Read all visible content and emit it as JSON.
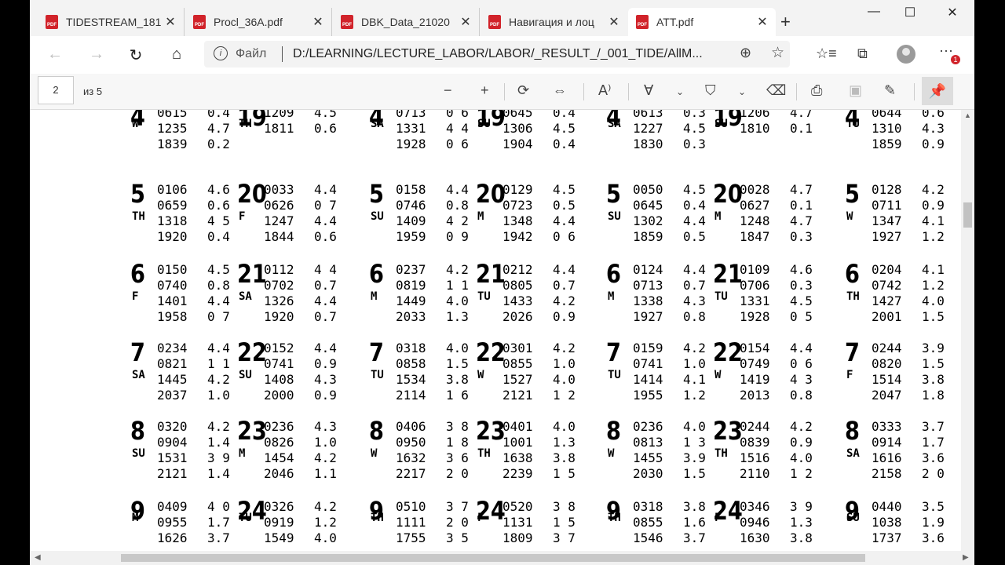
{
  "tabs": [
    {
      "title": "TIDESTREAM_181",
      "close": "✕"
    },
    {
      "title": "Procl_36A.pdf",
      "close": "✕"
    },
    {
      "title": "DBK_Data_21020",
      "close": "✕"
    },
    {
      "title": "Навигация и лоц",
      "close": "✕"
    },
    {
      "title": "ATT.pdf",
      "close": "✕"
    }
  ],
  "tab_icon_text": "PDF",
  "new_tab": "+",
  "window": {
    "minimize": "—",
    "maximize": "☐",
    "close": "✕"
  },
  "address": {
    "scheme_label": "Файл",
    "url": "D:/LEARNING/LECTURE_LABOR/LABOR/_RESULT_/_001_TIDE/AllM...",
    "notifications": "1"
  },
  "pdf_toolbar": {
    "page": "2",
    "of": "из 5"
  },
  "tide_rows": [
    {
      "cells": [
        {
          "day": "4",
          "wd": "W",
          "times": [
            "0615",
            "1235",
            "1839"
          ],
          "heights": [
            "0.4",
            "4.7",
            "0.2"
          ]
        },
        {
          "day": "19",
          "wd": "TH",
          "times": [
            "1209",
            "1811"
          ],
          "heights": [
            "4.5",
            "0.6"
          ]
        },
        {
          "day": "4",
          "wd": "SA",
          "times": [
            "0713",
            "1331",
            "1928"
          ],
          "heights": [
            "0 6",
            "4 4",
            "0 6"
          ]
        },
        {
          "day": "19",
          "wd": "SU",
          "times": [
            "0645",
            "1306",
            "1904"
          ],
          "heights": [
            "0.4",
            "4.5",
            "0.4"
          ]
        },
        {
          "day": "4",
          "wd": "SA",
          "times": [
            "0613",
            "1227",
            "1830"
          ],
          "heights": [
            "0.3",
            "4.5",
            "0.3"
          ]
        },
        {
          "day": "19",
          "wd": "SU",
          "times": [
            "1206",
            "1810"
          ],
          "heights": [
            "4.7",
            "0.1"
          ]
        },
        {
          "day": "4",
          "wd": "TU",
          "times": [
            "0644",
            "1310",
            "1859"
          ],
          "heights": [
            "0.6",
            "4.3",
            "0.9"
          ]
        }
      ]
    },
    {
      "cells": [
        {
          "day": "5",
          "wd": "TH",
          "times": [
            "0106",
            "0659",
            "1318",
            "1920"
          ],
          "heights": [
            "4.6",
            "0.6",
            "4 5",
            "0.4"
          ]
        },
        {
          "day": "20",
          "wd": "F",
          "times": [
            "0033",
            "0626",
            "1247",
            "1844"
          ],
          "heights": [
            "4.4",
            "0 7",
            "4.4",
            "0.6"
          ]
        },
        {
          "day": "5",
          "wd": "SU",
          "times": [
            "0158",
            "0746",
            "1409",
            "1959"
          ],
          "heights": [
            "4.4",
            "0.8",
            "4 2",
            "0 9"
          ]
        },
        {
          "day": "20",
          "wd": "M",
          "times": [
            "0129",
            "0723",
            "1348",
            "1942"
          ],
          "heights": [
            "4.5",
            "0.5",
            "4.4",
            "0 6"
          ]
        },
        {
          "day": "5",
          "wd": "SU",
          "times": [
            "0050",
            "0645",
            "1302",
            "1859"
          ],
          "heights": [
            "4.5",
            "0.4",
            "4.4",
            "0.5"
          ]
        },
        {
          "day": "20",
          "wd": "M",
          "times": [
            "0028",
            "0627",
            "1248",
            "1847"
          ],
          "heights": [
            "4.7",
            "0.1",
            "4.7",
            "0.3"
          ]
        },
        {
          "day": "5",
          "wd": "W",
          "times": [
            "0128",
            "0711",
            "1347",
            "1927"
          ],
          "heights": [
            "4.2",
            "0.9",
            "4.1",
            "1.2"
          ]
        }
      ]
    },
    {
      "cells": [
        {
          "day": "6",
          "wd": "F",
          "times": [
            "0150",
            "0740",
            "1401",
            "1958"
          ],
          "heights": [
            "4.5",
            "0.8",
            "4.4",
            "0 7"
          ]
        },
        {
          "day": "21",
          "wd": "SA",
          "times": [
            "0112",
            "0702",
            "1326",
            "1920"
          ],
          "heights": [
            "4 4",
            "0.7",
            "4.4",
            "0.7"
          ]
        },
        {
          "day": "6",
          "wd": "M",
          "times": [
            "0237",
            "0819",
            "1449",
            "2033"
          ],
          "heights": [
            "4.2",
            "1 1",
            "4.0",
            "1.3"
          ]
        },
        {
          "day": "21",
          "wd": "TU",
          "times": [
            "0212",
            "0805",
            "1433",
            "2026"
          ],
          "heights": [
            "4.4",
            "0.7",
            "4.2",
            "0.9"
          ]
        },
        {
          "day": "6",
          "wd": "M",
          "times": [
            "0124",
            "0713",
            "1338",
            "1927"
          ],
          "heights": [
            "4.4",
            "0.7",
            "4.3",
            "0.8"
          ]
        },
        {
          "day": "21",
          "wd": "TU",
          "times": [
            "0109",
            "0706",
            "1331",
            "1928"
          ],
          "heights": [
            "4.6",
            "0.3",
            "4.5",
            "0 5"
          ]
        },
        {
          "day": "6",
          "wd": "TH",
          "times": [
            "0204",
            "0742",
            "1427",
            "2001"
          ],
          "heights": [
            "4.1",
            "1.2",
            "4.0",
            "1.5"
          ]
        }
      ]
    },
    {
      "cells": [
        {
          "day": "7",
          "wd": "SA",
          "times": [
            "0234",
            "0821",
            "1445",
            "2037"
          ],
          "heights": [
            "4.4",
            "1 1",
            "4.2",
            "1.0"
          ]
        },
        {
          "day": "22",
          "wd": "SU",
          "times": [
            "0152",
            "0741",
            "1408",
            "2000"
          ],
          "heights": [
            "4.4",
            "0.9",
            "4.3",
            "0.9"
          ]
        },
        {
          "day": "7",
          "wd": "TU",
          "times": [
            "0318",
            "0858",
            "1534",
            "2114"
          ],
          "heights": [
            "4.0",
            "1.5",
            "3.8",
            "1 6"
          ]
        },
        {
          "day": "22",
          "wd": "W",
          "times": [
            "0301",
            "0855",
            "1527",
            "2121"
          ],
          "heights": [
            "4.2",
            "1.0",
            "4.0",
            "1 2"
          ]
        },
        {
          "day": "7",
          "wd": "TU",
          "times": [
            "0159",
            "0741",
            "1414",
            "1955"
          ],
          "heights": [
            "4.2",
            "1.0",
            "4.1",
            "1.2"
          ]
        },
        {
          "day": "22",
          "wd": "W",
          "times": [
            "0154",
            "0749",
            "1419",
            "2013"
          ],
          "heights": [
            "4.4",
            "0 6",
            "4 3",
            "0.8"
          ]
        },
        {
          "day": "7",
          "wd": "F",
          "times": [
            "0244",
            "0820",
            "1514",
            "2047"
          ],
          "heights": [
            "3.9",
            "1.5",
            "3.8",
            "1.8"
          ]
        }
      ]
    },
    {
      "cells": [
        {
          "day": "8",
          "wd": "SU",
          "times": [
            "0320",
            "0904",
            "1531",
            "2121"
          ],
          "heights": [
            "4.2",
            "1.4",
            "3 9",
            "1.4"
          ]
        },
        {
          "day": "23",
          "wd": "M",
          "times": [
            "0236",
            "0826",
            "1454",
            "2046"
          ],
          "heights": [
            "4.3",
            "1.0",
            "4.2",
            "1.1"
          ]
        },
        {
          "day": "8",
          "wd": "W",
          "times": [
            "0406",
            "0950",
            "1632",
            "2217"
          ],
          "heights": [
            "3 8",
            "1 8",
            "3 6",
            "2 0"
          ]
        },
        {
          "day": "23",
          "wd": "TH",
          "times": [
            "0401",
            "1001",
            "1638",
            "2239"
          ],
          "heights": [
            "4.0",
            "1.3",
            "3.8",
            "1 5"
          ]
        },
        {
          "day": "8",
          "wd": "W",
          "times": [
            "0236",
            "0813",
            "1455",
            "2030"
          ],
          "heights": [
            "4.0",
            "1 3",
            "3.9",
            "1.5"
          ]
        },
        {
          "day": "23",
          "wd": "TH",
          "times": [
            "0244",
            "0839",
            "1516",
            "2110"
          ],
          "heights": [
            "4.2",
            "0.9",
            "4.0",
            "1 2"
          ]
        },
        {
          "day": "8",
          "wd": "SA",
          "times": [
            "0333",
            "0914",
            "1616",
            "2158"
          ],
          "heights": [
            "3.7",
            "1.7",
            "3.6",
            "2 0"
          ]
        }
      ]
    },
    {
      "cells": [
        {
          "day": "9",
          "wd": "M",
          "times": [
            "0409",
            "0955",
            "1626"
          ],
          "heights": [
            "4 0",
            "1.7",
            "3.7"
          ]
        },
        {
          "day": "24",
          "wd": "TU",
          "times": [
            "0326",
            "0919",
            "1549"
          ],
          "heights": [
            "4.2",
            "1.2",
            "4.0"
          ]
        },
        {
          "day": "9",
          "wd": "TH",
          "times": [
            "0510",
            "1111",
            "1755"
          ],
          "heights": [
            "3 7",
            "2 0",
            "3 5"
          ]
        },
        {
          "day": "24",
          "wd": "F",
          "times": [
            "0520",
            "1131",
            "1809"
          ],
          "heights": [
            "3 8",
            "1 5",
            "3 7"
          ]
        },
        {
          "day": "9",
          "wd": "TH",
          "times": [
            "0318",
            "0855",
            "1546"
          ],
          "heights": [
            "3.8",
            "1.6",
            "3.7"
          ]
        },
        {
          "day": "24",
          "wd": "F",
          "times": [
            "0346",
            "0946",
            "1630"
          ],
          "heights": [
            "3 9",
            "1.3",
            "3.8"
          ]
        },
        {
          "day": "9",
          "wd": "SU",
          "times": [
            "0440",
            "1038",
            "1737"
          ],
          "heights": [
            "3.5",
            "1.9",
            "3.6"
          ]
        }
      ]
    }
  ]
}
